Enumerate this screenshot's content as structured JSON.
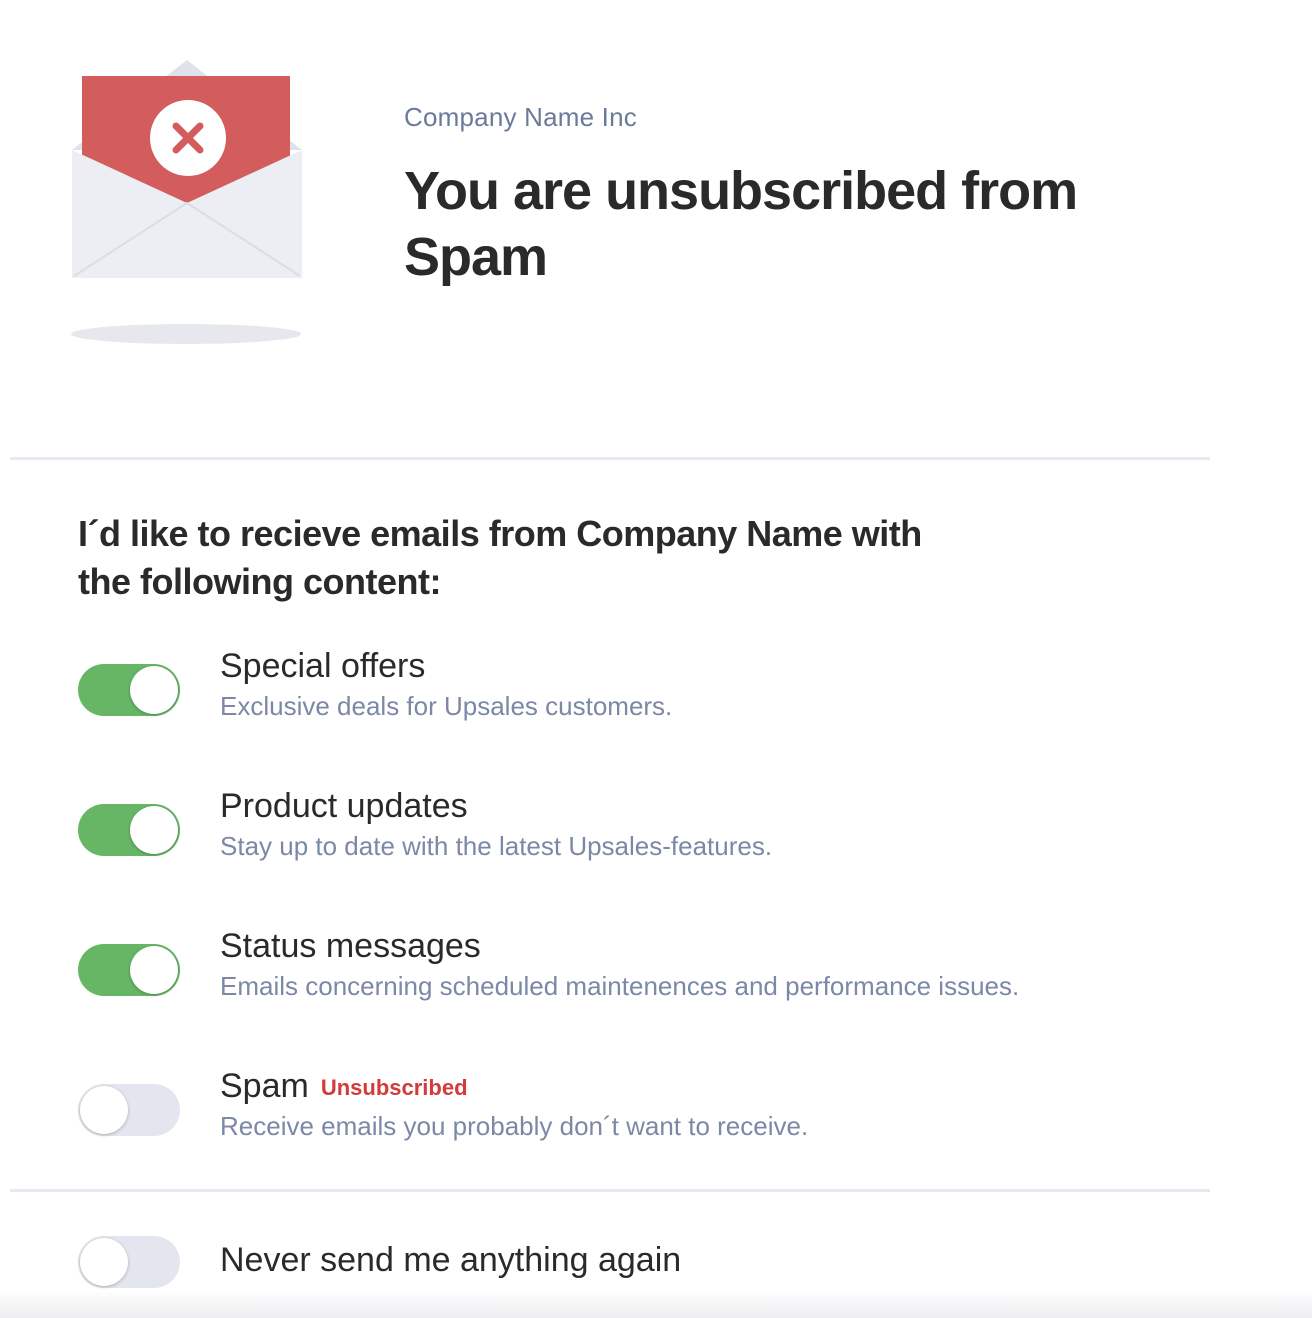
{
  "header": {
    "company": "Company Name Inc",
    "headline": "You are unsubscribed from Spam",
    "illustration_icon": "envelope-unsubscribed-icon"
  },
  "preferences": {
    "heading": "I´d like to recieve emails from Company Name with the following content:",
    "items": [
      {
        "title": "Special offers",
        "description": "Exclusive deals for Upsales customers.",
        "enabled": true,
        "badge": ""
      },
      {
        "title": "Product updates",
        "description": "Stay up to date with the latest Upsales-features.",
        "enabled": true,
        "badge": ""
      },
      {
        "title": "Status messages",
        "description": "Emails concerning scheduled maintenences and performance issues.",
        "enabled": true,
        "badge": ""
      },
      {
        "title": "Spam",
        "description": "Receive emails you probably don´t want to receive.",
        "enabled": false,
        "badge": "Unsubscribed"
      }
    ]
  },
  "never_send": {
    "label": "Never send me anything again",
    "enabled": false
  },
  "colors": {
    "toggle_on": "#66b666",
    "toggle_off": "#e3e6ee",
    "badge_red": "#d33a3a",
    "envelope_letter": "#d35c5c"
  }
}
